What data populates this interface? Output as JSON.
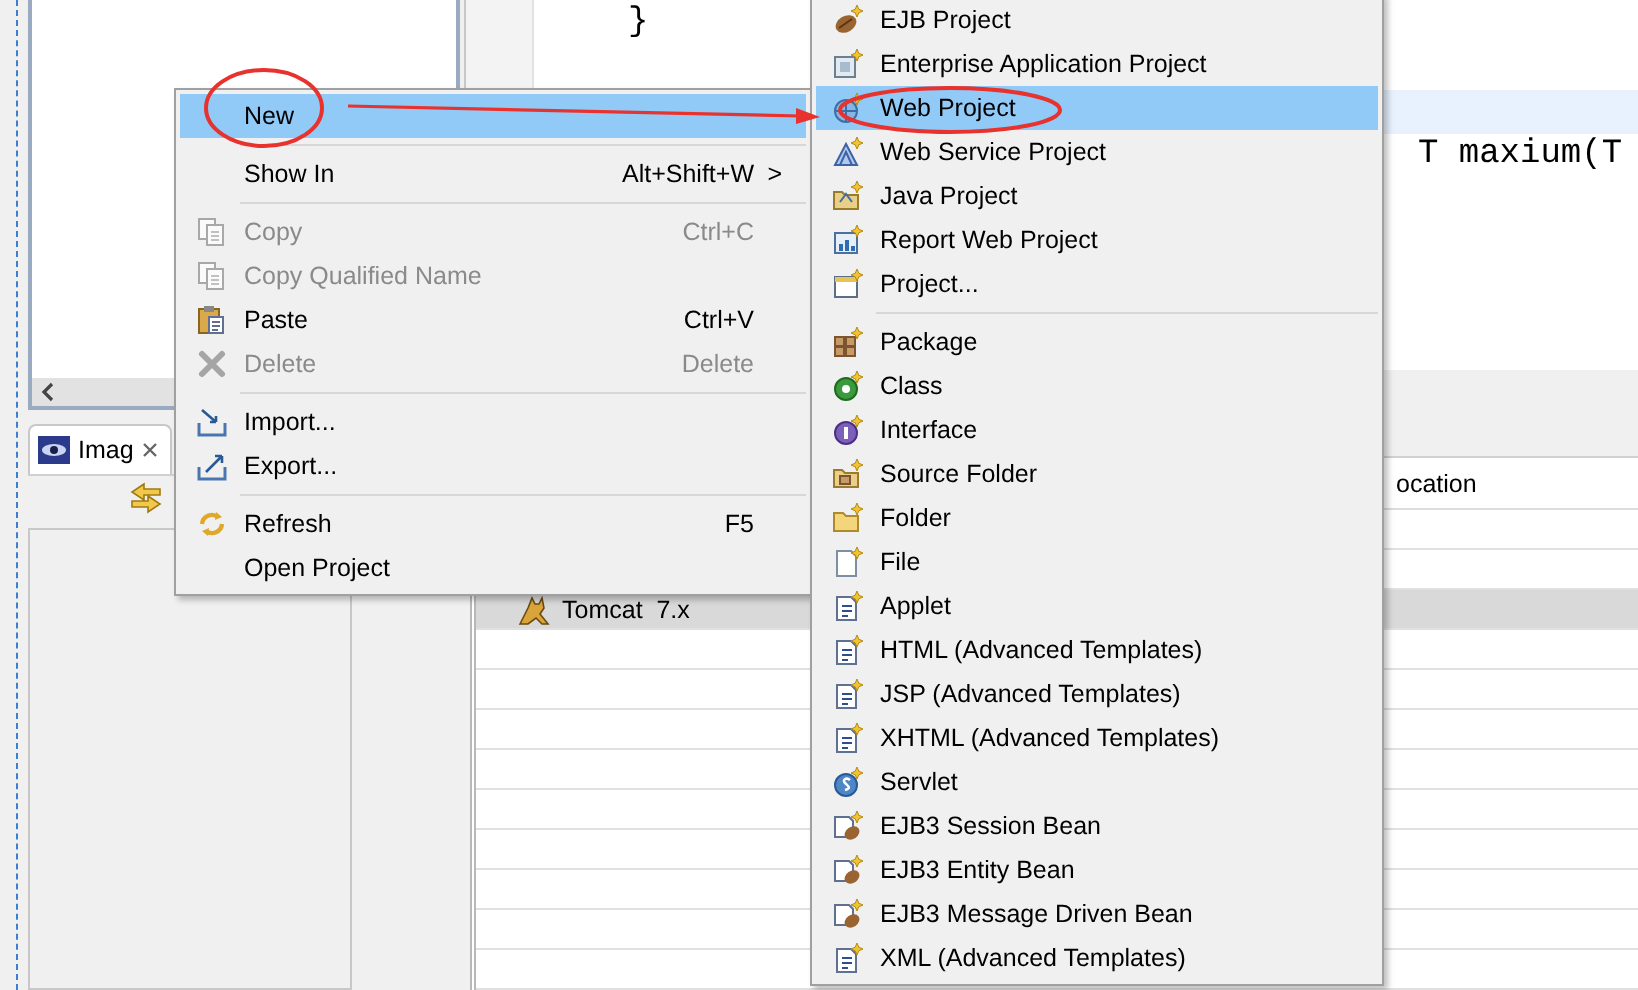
{
  "editor": {
    "lines": [
      {
        "text": "}",
        "current": false
      },
      {
        "current": false
      },
      {
        "current": true
      },
      {
        "text": "T maxium(T",
        "current": false
      }
    ]
  },
  "image_view": {
    "tab": {
      "label": "Imag",
      "selected": true
    }
  },
  "servers_table": {
    "columns": [
      {
        "label": "ocation"
      }
    ],
    "rows": [
      {
        "label": "Tomcat  7.x",
        "selected": true
      }
    ]
  },
  "context_menu": {
    "items": [
      {
        "kind": "item",
        "label": "New",
        "selected": true,
        "disabled": false
      },
      {
        "kind": "separator"
      },
      {
        "kind": "item",
        "label": "Show In",
        "shortcut": "Alt+Shift+W",
        "arrow": ">",
        "selected": false,
        "disabled": false
      },
      {
        "kind": "separator"
      },
      {
        "kind": "item",
        "label": "Copy",
        "shortcut": "Ctrl+C",
        "selected": false,
        "disabled": true
      },
      {
        "kind": "item",
        "label": "Copy Qualified Name",
        "selected": false,
        "disabled": true
      },
      {
        "kind": "item",
        "label": "Paste",
        "shortcut": "Ctrl+V",
        "selected": false,
        "disabled": false
      },
      {
        "kind": "item",
        "label": "Delete",
        "shortcut": "Delete",
        "selected": false,
        "disabled": true
      },
      {
        "kind": "separator"
      },
      {
        "kind": "item",
        "label": "Import...",
        "selected": false,
        "disabled": false
      },
      {
        "kind": "item",
        "label": "Export...",
        "selected": false,
        "disabled": false
      },
      {
        "kind": "separator"
      },
      {
        "kind": "item",
        "label": "Refresh",
        "shortcut": "F5",
        "selected": false,
        "disabled": false
      },
      {
        "kind": "item",
        "label": "Open Project",
        "selected": false,
        "disabled": false
      }
    ]
  },
  "new_submenu": {
    "items": [
      {
        "kind": "item",
        "label": "EJB Project",
        "selected": false
      },
      {
        "kind": "item",
        "label": "Enterprise Application Project",
        "selected": false
      },
      {
        "kind": "item",
        "label": "Web Project",
        "selected": true
      },
      {
        "kind": "item",
        "label": "Web Service Project",
        "selected": false
      },
      {
        "kind": "item",
        "label": "Java Project",
        "selected": false
      },
      {
        "kind": "item",
        "label": "Report Web Project",
        "selected": false
      },
      {
        "kind": "item",
        "label": "Project...",
        "selected": false
      },
      {
        "kind": "separator"
      },
      {
        "kind": "item",
        "label": "Package",
        "selected": false
      },
      {
        "kind": "item",
        "label": "Class",
        "selected": false
      },
      {
        "kind": "item",
        "label": "Interface",
        "selected": false
      },
      {
        "kind": "item",
        "label": "Source Folder",
        "selected": false
      },
      {
        "kind": "item",
        "label": "Folder",
        "selected": false
      },
      {
        "kind": "item",
        "label": "File",
        "selected": false
      },
      {
        "kind": "item",
        "label": "Applet",
        "selected": false
      },
      {
        "kind": "item",
        "label": "HTML (Advanced Templates)",
        "selected": false
      },
      {
        "kind": "item",
        "label": "JSP (Advanced Templates)",
        "selected": false
      },
      {
        "kind": "item",
        "label": "XHTML (Advanced Templates)",
        "selected": false
      },
      {
        "kind": "item",
        "label": "Servlet",
        "selected": false
      },
      {
        "kind": "item",
        "label": "EJB3 Session Bean",
        "selected": false
      },
      {
        "kind": "item",
        "label": "EJB3 Entity Bean",
        "selected": false
      },
      {
        "kind": "item",
        "label": "EJB3 Message Driven Bean",
        "selected": false
      },
      {
        "kind": "item",
        "label": "XML (Advanced Templates)",
        "selected": false
      }
    ]
  }
}
